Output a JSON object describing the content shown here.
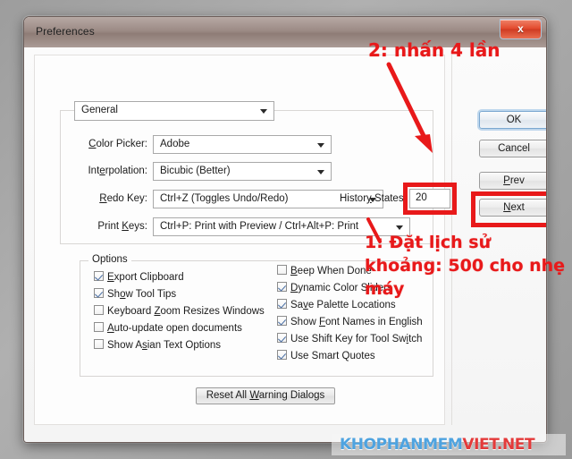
{
  "window": {
    "title": "Preferences",
    "close_label": "x"
  },
  "category": {
    "selected": "General"
  },
  "fields": [
    {
      "key": "color_picker",
      "label": "Color Picker:",
      "value": "Adobe"
    },
    {
      "key": "interpolation",
      "label": "Interpolation:",
      "value": "Bicubic (Better)"
    },
    {
      "key": "redo_key",
      "label": "Redo Key:",
      "value": "Ctrl+Z (Toggles Undo/Redo)"
    },
    {
      "key": "print_keys",
      "label": "Print Keys:",
      "value": "Ctrl+P: Print with Preview / Ctrl+Alt+P: Print"
    }
  ],
  "history_states": {
    "label": "History States",
    "value": "20"
  },
  "options": {
    "legend": "Options",
    "left_column": [
      {
        "label": "Export Clipboard",
        "checked": true
      },
      {
        "label": "Show Tool Tips",
        "checked": true
      },
      {
        "label": "Keyboard Zoom Resizes Windows",
        "checked": false
      },
      {
        "label": "Auto-update open documents",
        "checked": false
      },
      {
        "label": "Show Asian Text Options",
        "checked": false
      }
    ],
    "right_column": [
      {
        "label": "Beep When Done",
        "checked": false
      },
      {
        "label": "Dynamic Color Sliders",
        "checked": true
      },
      {
        "label": "Save Palette Locations",
        "checked": true
      },
      {
        "label": "Show Font Names in English",
        "checked": true
      },
      {
        "label": "Use Shift Key for Tool Switch",
        "checked": true
      },
      {
        "label": "Use Smart Quotes",
        "checked": true
      }
    ]
  },
  "reset_button": {
    "label": "Reset All Warning Dialogs"
  },
  "buttons": {
    "ok": "OK",
    "cancel": "Cancel",
    "prev": "Prev",
    "next": "Next"
  },
  "annotations": {
    "step2": "2: nhấn 4 lần",
    "step1": "1: Đặt lịch sử khoảng: 500 cho nhẹ máy",
    "highlight_color": "#e8191a"
  },
  "watermark": {
    "part_blue": "KHOPHANMEM",
    "part_red": "VIET.NET",
    "color_blue": "#4ea3e0",
    "color_red": "#e43a3a"
  }
}
